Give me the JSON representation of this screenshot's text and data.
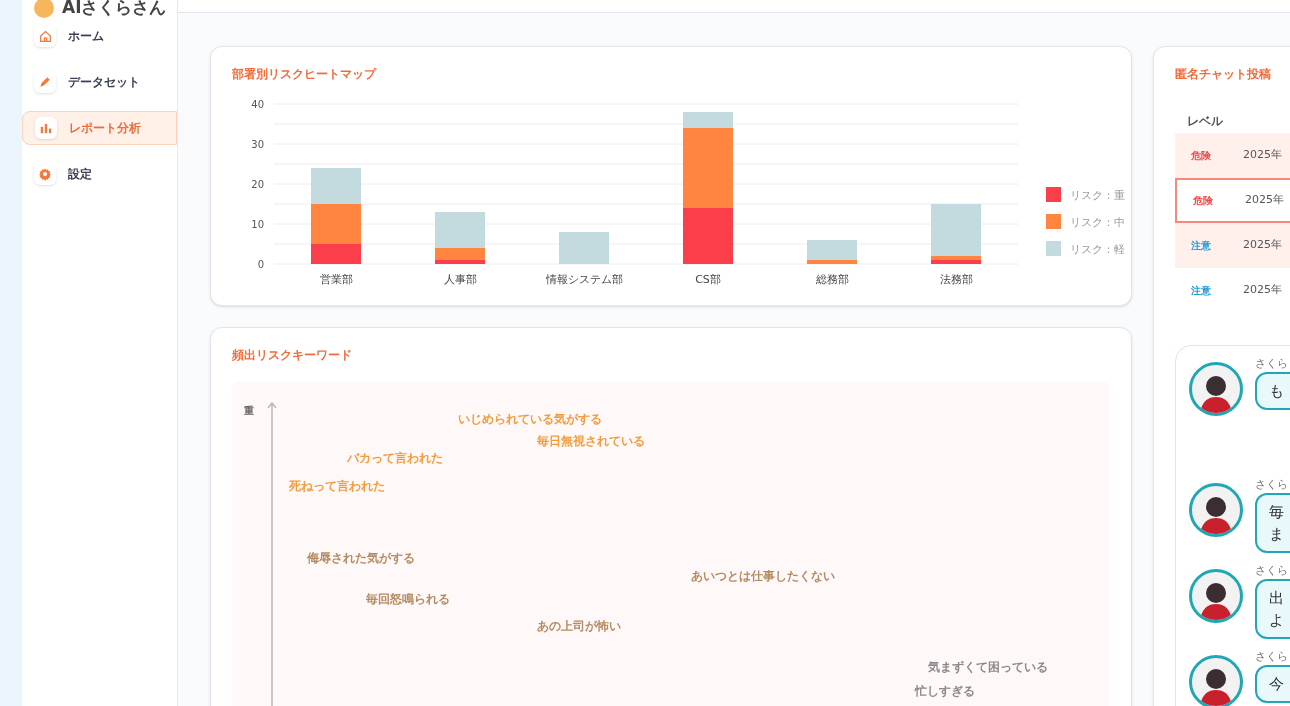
{
  "app": {
    "title": "AIさくらさん"
  },
  "sidebar": {
    "items": [
      {
        "label": "ホーム",
        "selected": false
      },
      {
        "label": "データセット",
        "selected": false
      },
      {
        "label": "レポート分析",
        "selected": true
      },
      {
        "label": "設定",
        "selected": false
      }
    ]
  },
  "heatmap": {
    "title": "部署別リスクヒートマップ",
    "chart_data": {
      "type": "bar",
      "stacked": true,
      "grid": true,
      "legend": true,
      "categories": [
        "営業部",
        "人事部",
        "情報システム部",
        "CS部",
        "総務部",
        "法務部"
      ],
      "ylim": [
        0,
        40
      ],
      "yticks": [
        0,
        10,
        20,
        30,
        40
      ],
      "series": [
        {
          "name": "リスク：重",
          "color": "#fb3f4a",
          "values": [
            5,
            1,
            0,
            14,
            0,
            1
          ]
        },
        {
          "name": "リスク：中",
          "color": "#ff8540",
          "values": [
            10,
            3,
            0,
            20,
            1,
            1
          ]
        },
        {
          "name": "リスク：軽",
          "color": "#c3dbdf",
          "values": [
            9,
            9,
            8,
            4,
            5,
            13
          ]
        }
      ]
    }
  },
  "keywords": {
    "title": "頻出リスクキーワード",
    "axis_label": "重",
    "words": [
      {
        "text": "いじめられている気がする",
        "color": "#f39c3c"
      },
      {
        "text": "毎日無視されている",
        "color": "#f39c3c"
      },
      {
        "text": "バカって言われた",
        "color": "#f39c3c"
      },
      {
        "text": "死ねって言われた",
        "color": "#f39c3c"
      },
      {
        "text": "侮辱された気がする",
        "color": "#b48c62"
      },
      {
        "text": "あいつとは仕事したくない",
        "color": "#b48c62"
      },
      {
        "text": "毎回怒鳴られる",
        "color": "#b48c62"
      },
      {
        "text": "あの上司が怖い",
        "color": "#b48c62"
      },
      {
        "text": "気まずくて困っている",
        "color": "#8a8a8a"
      },
      {
        "text": "忙しすぎる",
        "color": "#8a8a8a"
      }
    ]
  },
  "chat_log": {
    "title": "匿名チャット投稿",
    "columns": [
      "レベル"
    ],
    "rows": [
      {
        "level": "危険",
        "kind": "danger",
        "date": "2025年",
        "selected": false
      },
      {
        "level": "危険",
        "kind": "danger",
        "date": "2025年",
        "selected": true
      },
      {
        "level": "注意",
        "kind": "caution",
        "date": "2025年",
        "selected": false
      },
      {
        "level": "注意",
        "kind": "caution",
        "date": "2025年",
        "selected": false
      }
    ]
  },
  "chat": {
    "messages": [
      {
        "sender": "さくら",
        "lines": [
          "も"
        ]
      },
      {
        "sender": "さくら",
        "lines": [
          "毎",
          "ま"
        ]
      },
      {
        "sender": "さくら",
        "lines": [
          "出",
          "よ"
        ]
      },
      {
        "sender": "さくら",
        "lines": [
          "今"
        ]
      }
    ]
  }
}
